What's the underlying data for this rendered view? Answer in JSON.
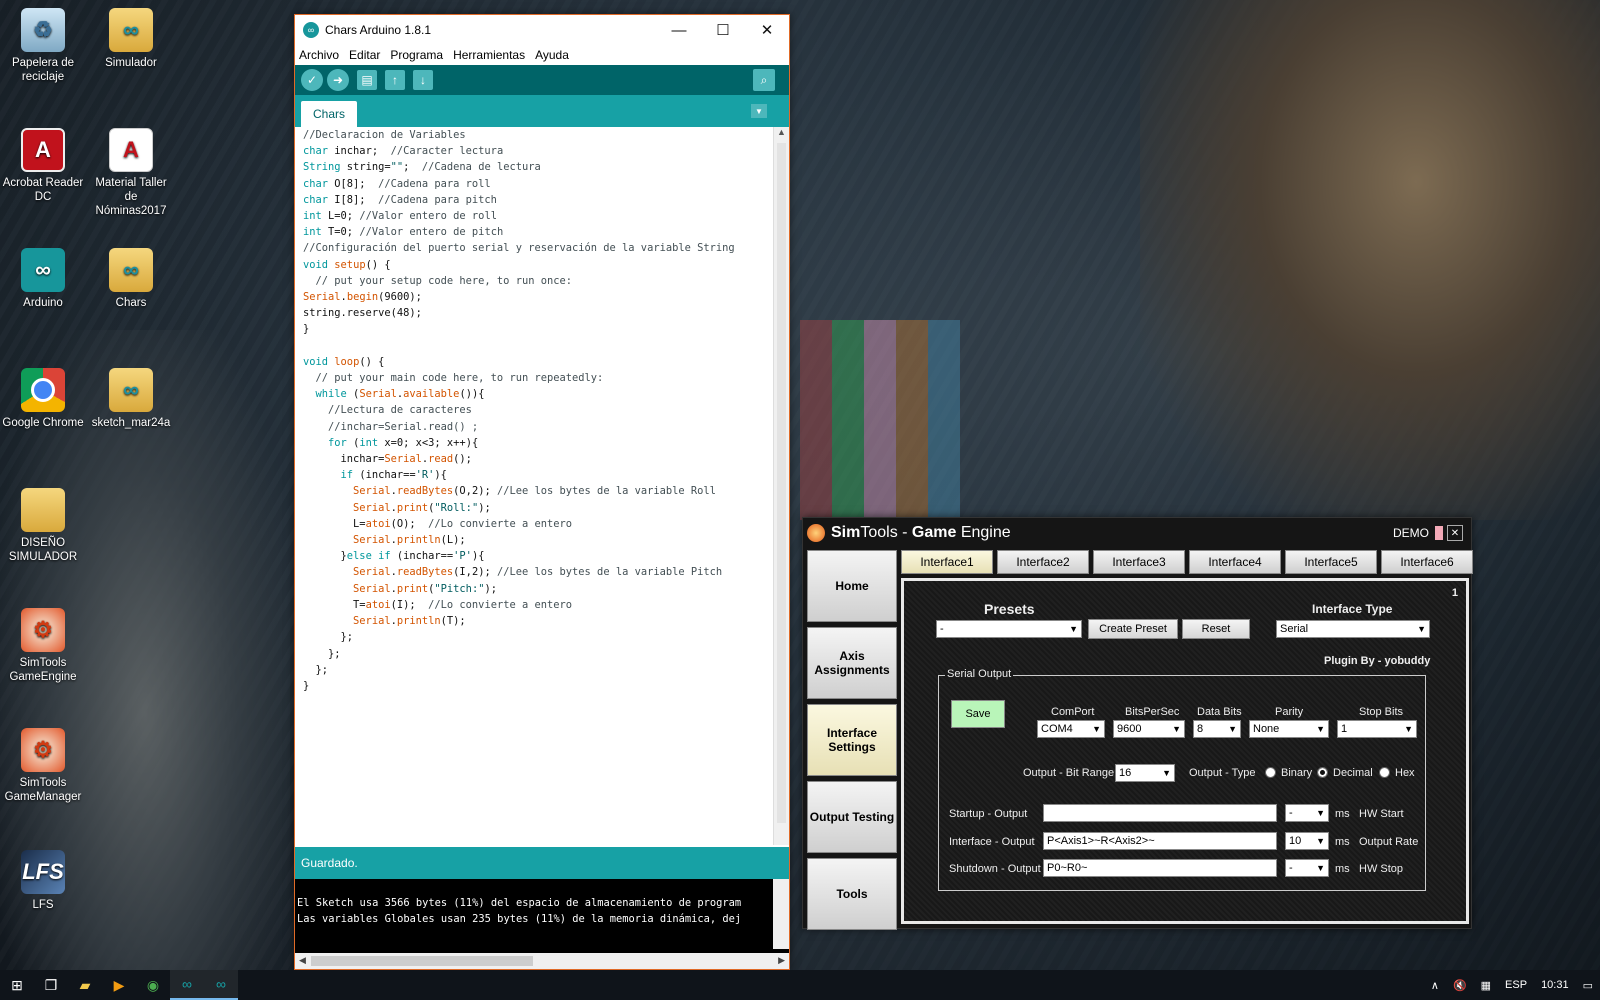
{
  "desktop": {
    "icons": [
      {
        "label": "Papelera de reciclaje",
        "icon": "recycle-bin-icon"
      },
      {
        "label": "Simulador",
        "icon": "folder-icon"
      },
      {
        "label": "Acrobat Reader DC",
        "icon": "acrobat-icon"
      },
      {
        "label": "Material Taller de Nóminas2017",
        "icon": "pdf-file-icon"
      },
      {
        "label": "Arduino",
        "icon": "arduino-icon"
      },
      {
        "label": "Chars",
        "icon": "folder-icon"
      },
      {
        "label": "Google Chrome",
        "icon": "chrome-icon"
      },
      {
        "label": "sketch_mar24a",
        "icon": "folder-icon"
      },
      {
        "label": "DISEÑO SIMULADOR",
        "icon": "folder-icon"
      },
      {
        "label": "SimTools GameEngine",
        "icon": "simtools-icon"
      },
      {
        "label": "SimTools GameManager",
        "icon": "simtools-icon"
      },
      {
        "label": "LFS",
        "icon": "lfs-icon"
      }
    ]
  },
  "arduino": {
    "title": "Chars Arduino 1.8.1",
    "menu": [
      "Archivo",
      "Editar",
      "Programa",
      "Herramientas",
      "Ayuda"
    ],
    "tab": "Chars",
    "status": "Guardado.",
    "console": [
      "El Sketch usa 3566 bytes (11%) del espacio de almacenamiento de program",
      "Las variables Globales usan 235 bytes (11%) de la memoria dinámica, dej"
    ]
  },
  "simtools": {
    "title_sim": "Sim",
    "title_tools": "Tools - ",
    "title_game": "Game",
    "title_engine": " Engine",
    "demo": "DEMO",
    "nav": [
      "Home",
      "Axis Assignments",
      "Interface Settings",
      "Output Testing",
      "Tools"
    ],
    "tabs": [
      "Interface1",
      "Interface2",
      "Interface3",
      "Interface4",
      "Interface5",
      "Interface6"
    ],
    "panel_number": "1",
    "presets_label": "Presets",
    "presets_value": "-",
    "create_preset": "Create Preset",
    "reset": "Reset",
    "interface_type_label": "Interface Type",
    "interface_type_value": "Serial",
    "plugin_by": "Plugin By - yobuddy",
    "serial_output": "Serial Output",
    "save": "Save",
    "comport_label": "ComPort",
    "comport": "COM4",
    "bits_label": "BitsPerSec",
    "bits": "9600",
    "databits_label": "Data Bits",
    "databits": "8",
    "parity_label": "Parity",
    "parity": "None",
    "stopbits_label": "Stop Bits",
    "stopbits": "1",
    "bitrange_label": "Output - Bit Range",
    "bitrange": "16",
    "outtype_label": "Output - Type",
    "binary": "Binary",
    "decimal": "Decimal",
    "hex": "Hex",
    "startup_label": "Startup - Output",
    "startup_value": "",
    "startup_ms": "-",
    "hw_start": "HW Start",
    "interface_label": "Interface - Output",
    "interface_value": "P<Axis1>~R<Axis2>~",
    "interface_ms": "10",
    "output_rate": "Output Rate",
    "shutdown_label": "Shutdown - Output",
    "shutdown_value": "P0~R0~",
    "shutdown_ms": "-",
    "hw_stop": "HW Stop",
    "ms": "ms"
  },
  "taskbar": {
    "lang": "ESP",
    "time": "10:31"
  }
}
